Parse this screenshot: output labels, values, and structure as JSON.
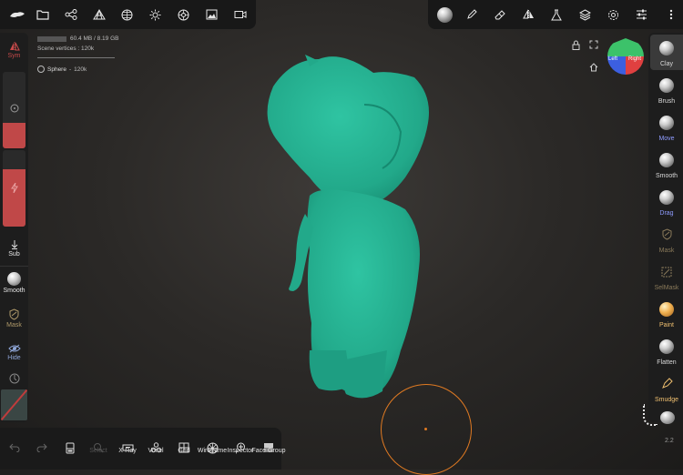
{
  "top_left_icons": [
    "nomad-logo-icon",
    "folder-icon",
    "share-nodes-icon",
    "scene-tree-icon",
    "sphere-wireframe-icon",
    "sun-icon",
    "material-icon",
    "image-icon",
    "camera-video-icon"
  ],
  "top_right_icons": [
    "matcap-ball-icon",
    "pen-stroke-icon",
    "eraser-icon",
    "symmetry-icon",
    "flask-icon",
    "layers-icon",
    "gear-icon",
    "sliders-icon",
    "more-vertical-icon"
  ],
  "left_panel": {
    "sym_label": "Sym",
    "sub_label": "Sub",
    "smooth_label": "Smooth",
    "mask_label": "Mask",
    "hide_label": "Hide"
  },
  "stats": {
    "memory": "60.4 MB / 8.19 GB",
    "vertices": "Scene vertices : 120k",
    "mesh_name": "Sphere",
    "mesh_vertices": "120k"
  },
  "view_cube": {
    "left": "Left",
    "right": "Right"
  },
  "right_tools": [
    {
      "label": "Clay",
      "color": "#d9d9d9",
      "selected": true
    },
    {
      "label": "Brush",
      "color": "#d9d9d9"
    },
    {
      "label": "Move",
      "color": "#8f9cff"
    },
    {
      "label": "Smooth",
      "color": "#d9d9d9"
    },
    {
      "label": "Drag",
      "color": "#8f9cff"
    },
    {
      "label": "Mask",
      "color": "#8a7a5a"
    },
    {
      "label": "SelMask",
      "color": "#8a7a5a"
    },
    {
      "label": "Paint",
      "color": "#f0c070"
    },
    {
      "label": "Flatten",
      "color": "#d9d9d9"
    },
    {
      "label": "Smudge",
      "color": "#f0c070"
    }
  ],
  "bottom_bar": {
    "undo_label": "",
    "redo_label": "",
    "voxel_icon_label": "",
    "search_label": "Select",
    "xray_label": "X-Ray",
    "voxel_label": "Voxel",
    "grid_label": "Grid",
    "wireframe_label": "Wireframe",
    "inspector_label": "Inspector",
    "facegroup_label": "Face Group"
  },
  "version": "2.2",
  "colors": {
    "mesh": "#26b495",
    "cursor": "#e07a22",
    "sym_red": "#c84a4a",
    "accent_red": "#c03c3c"
  }
}
